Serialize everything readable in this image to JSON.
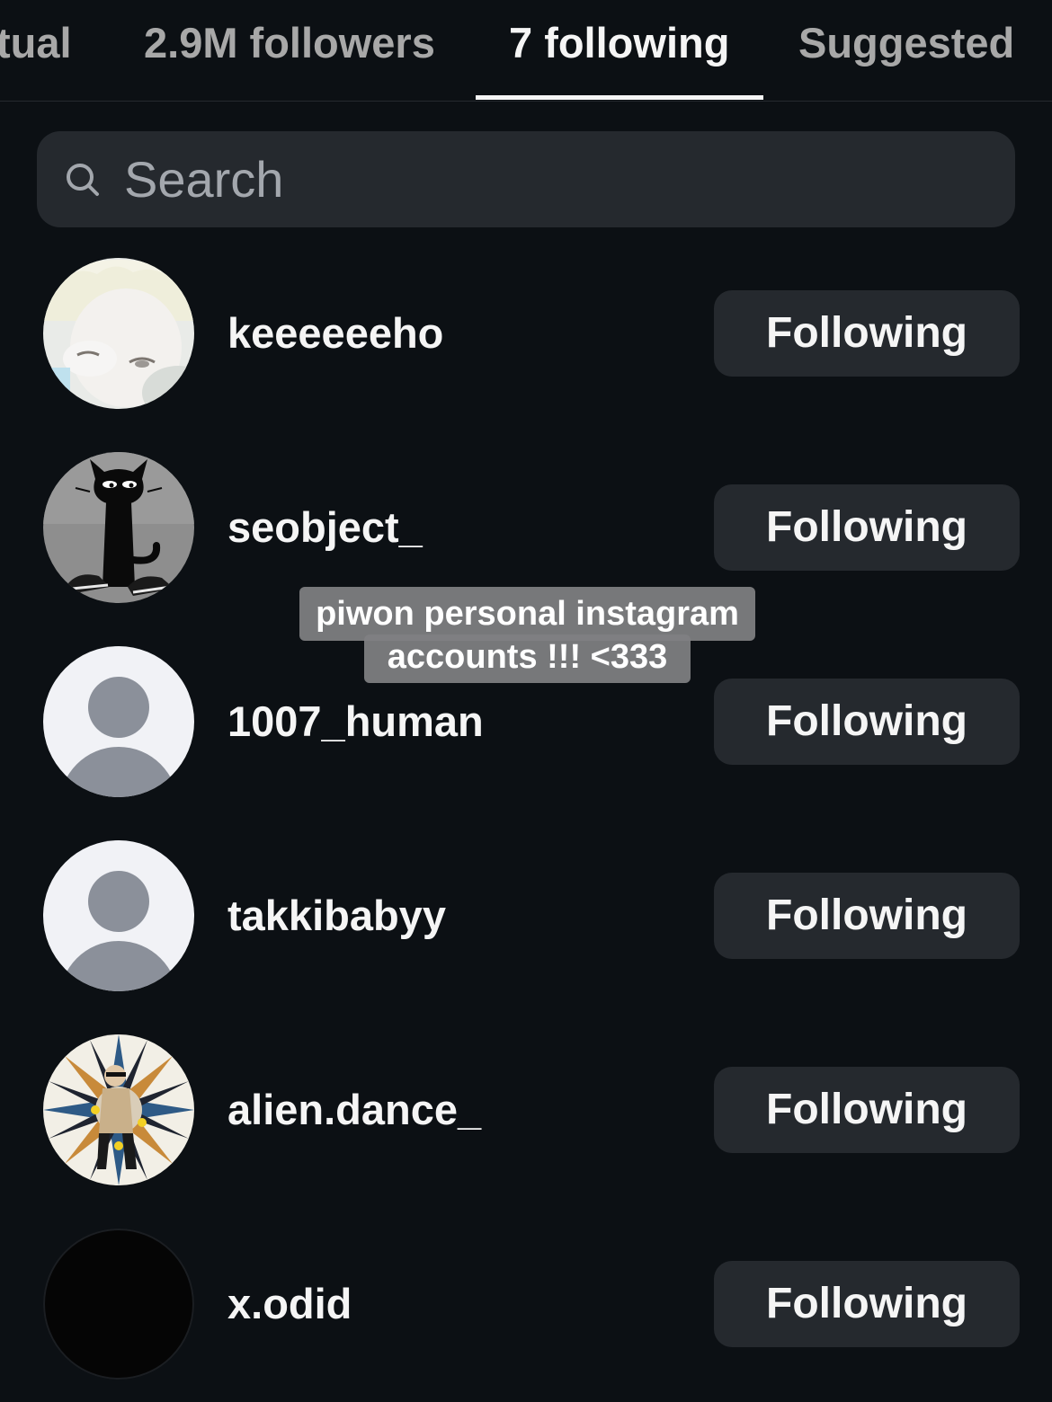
{
  "tabs": [
    {
      "label": "tual",
      "active": false
    },
    {
      "label": "2.9M followers",
      "active": false
    },
    {
      "label": "7 following",
      "active": true
    },
    {
      "label": "Suggested",
      "active": false
    }
  ],
  "search": {
    "placeholder": "Search",
    "value": ""
  },
  "following": [
    {
      "username": "keeeeeeho",
      "button_label": "Following",
      "avatar": "photo-blonde-face"
    },
    {
      "username": "seobject_",
      "button_label": "Following",
      "avatar": "black-cat-illustration"
    },
    {
      "username": "1007_human",
      "button_label": "Following",
      "avatar": "default-profile"
    },
    {
      "username": "takkibabyy",
      "button_label": "Following",
      "avatar": "default-profile"
    },
    {
      "username": "alien.dance_",
      "button_label": "Following",
      "avatar": "psychedelic-burst-photo"
    },
    {
      "username": "x.odid",
      "button_label": "Following",
      "avatar": "black-circle"
    }
  ],
  "caption": {
    "line1": "piwon personal instagram",
    "line2": "accounts !!! <333"
  },
  "colors": {
    "background": "#0c1014",
    "surface": "#25292e",
    "text": "#f5f5f5",
    "muted": "#a8a8a8",
    "caption_bg": "#808082"
  }
}
